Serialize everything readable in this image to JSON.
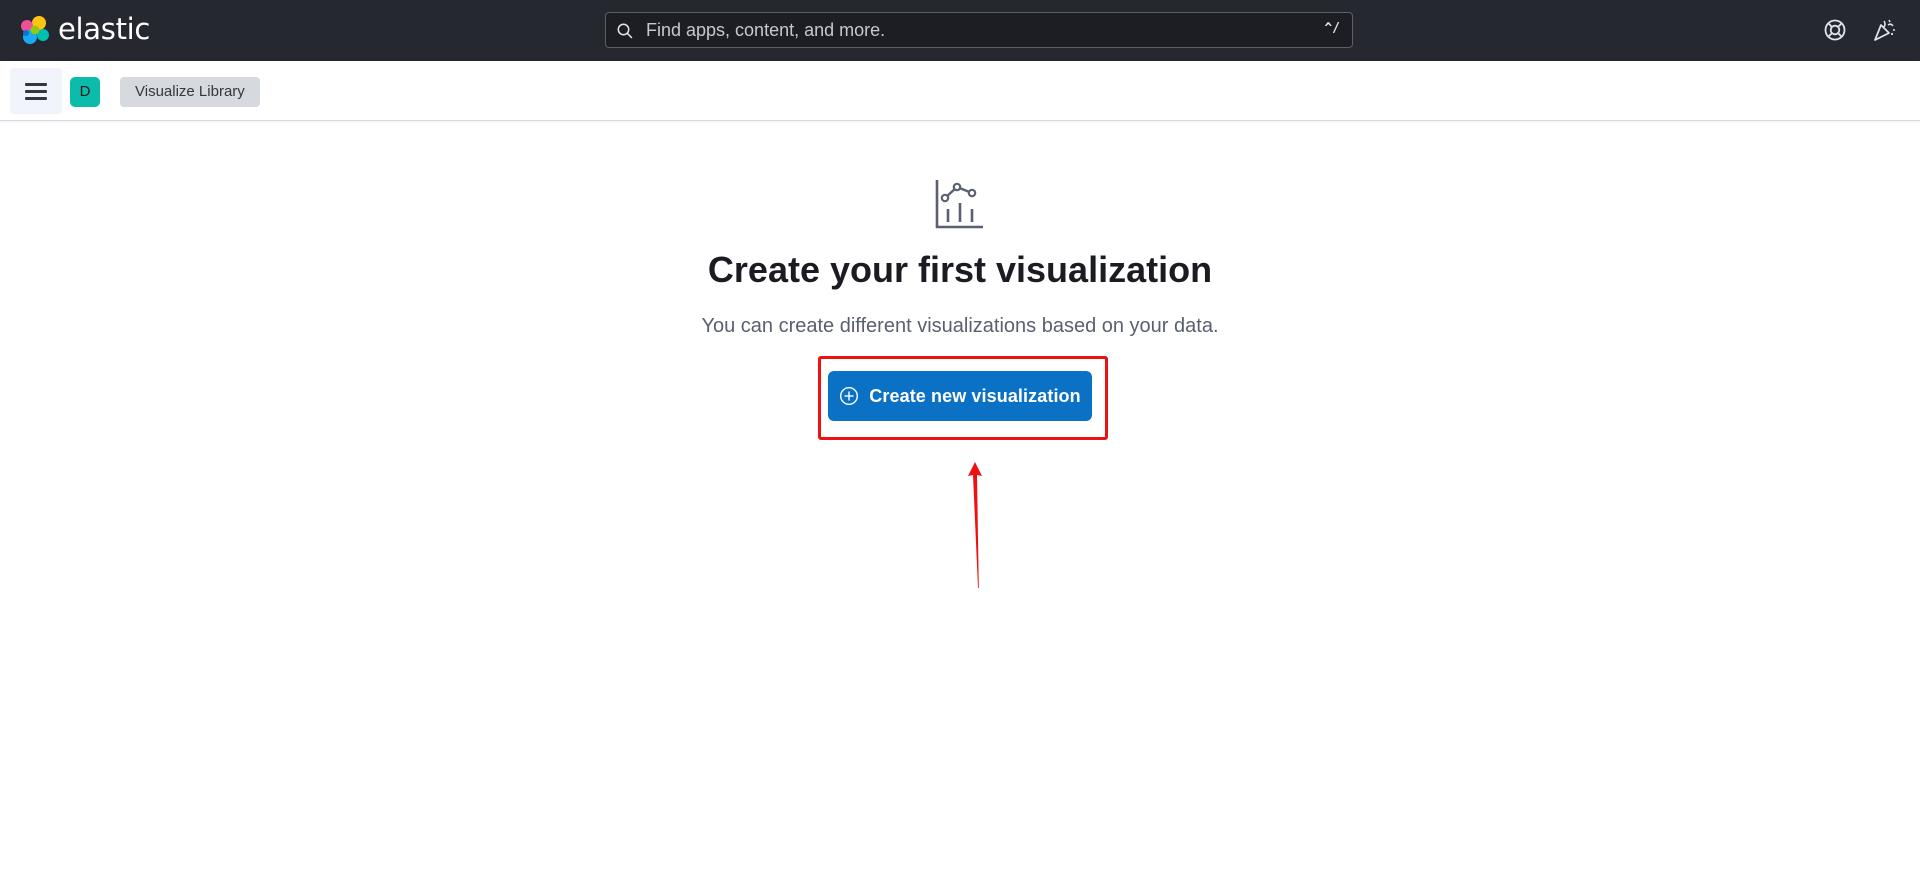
{
  "header": {
    "brand_name": "elastic",
    "brand_logo": "elastic-logo-icon",
    "search": {
      "placeholder": "Find apps, content, and more.",
      "shortcut": "^/",
      "icon": "search-icon"
    },
    "right_icons": [
      "help-icon",
      "news-icon"
    ]
  },
  "nav_bar": {
    "menu_icon": "hamburger-menu-icon",
    "space_avatar_letter": "D",
    "breadcrumb": "Visualize Library"
  },
  "empty_prompt": {
    "icon": "visualize-app-icon",
    "title": "Create your first visualization",
    "body": "You can create different visualizations based on your data.",
    "button_label": "Create new visualization",
    "button_icon": "plus-in-circle-icon"
  },
  "colors": {
    "header_bg": "#25282f",
    "primary_button": "#0b71c5",
    "space_avatar": "#0cbcaa",
    "annotation": "#ee1111"
  }
}
